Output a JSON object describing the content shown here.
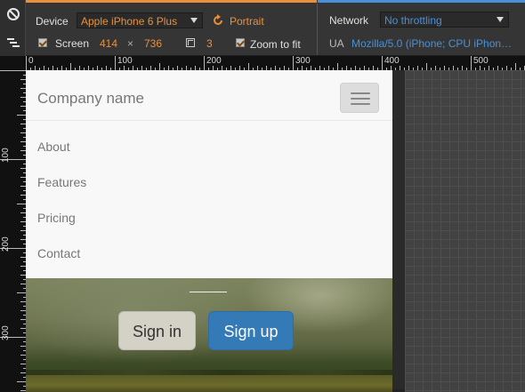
{
  "toolbar": {
    "device_label": "Device",
    "device_value": "Apple iPhone 6 Plus",
    "orientation_label": "Portrait",
    "screen_label": "Screen",
    "screen_width": "414",
    "screen_times": "×",
    "screen_height": "736",
    "scale_value": "3",
    "zoom_label": "Zoom to fit",
    "network_label": "Network",
    "network_value": "No throttling",
    "ua_label": "UA",
    "ua_value": "Mozilla/5.0 (iPhone; CPU iPhon…"
  },
  "ruler": {
    "top": [
      "0",
      "100",
      "200",
      "300",
      "400",
      "500"
    ],
    "left": [
      "100",
      "200",
      "300"
    ]
  },
  "page": {
    "brand": "Company name",
    "nav_items": [
      "About",
      "Features",
      "Pricing",
      "Contact"
    ],
    "signin_label": "Sign in",
    "signup_label": "Sign up"
  },
  "colors": {
    "accent_orange": "#e8913a",
    "accent_blue": "#4a90d9",
    "primary_button": "#337ab7"
  },
  "icons": {
    "disable_emulation": "no-entry-icon",
    "toggle_drawer": "drawer-lines-icon",
    "rotate": "rotate-icon",
    "scale": "device-scale-icon",
    "menu": "hamburger-icon"
  }
}
